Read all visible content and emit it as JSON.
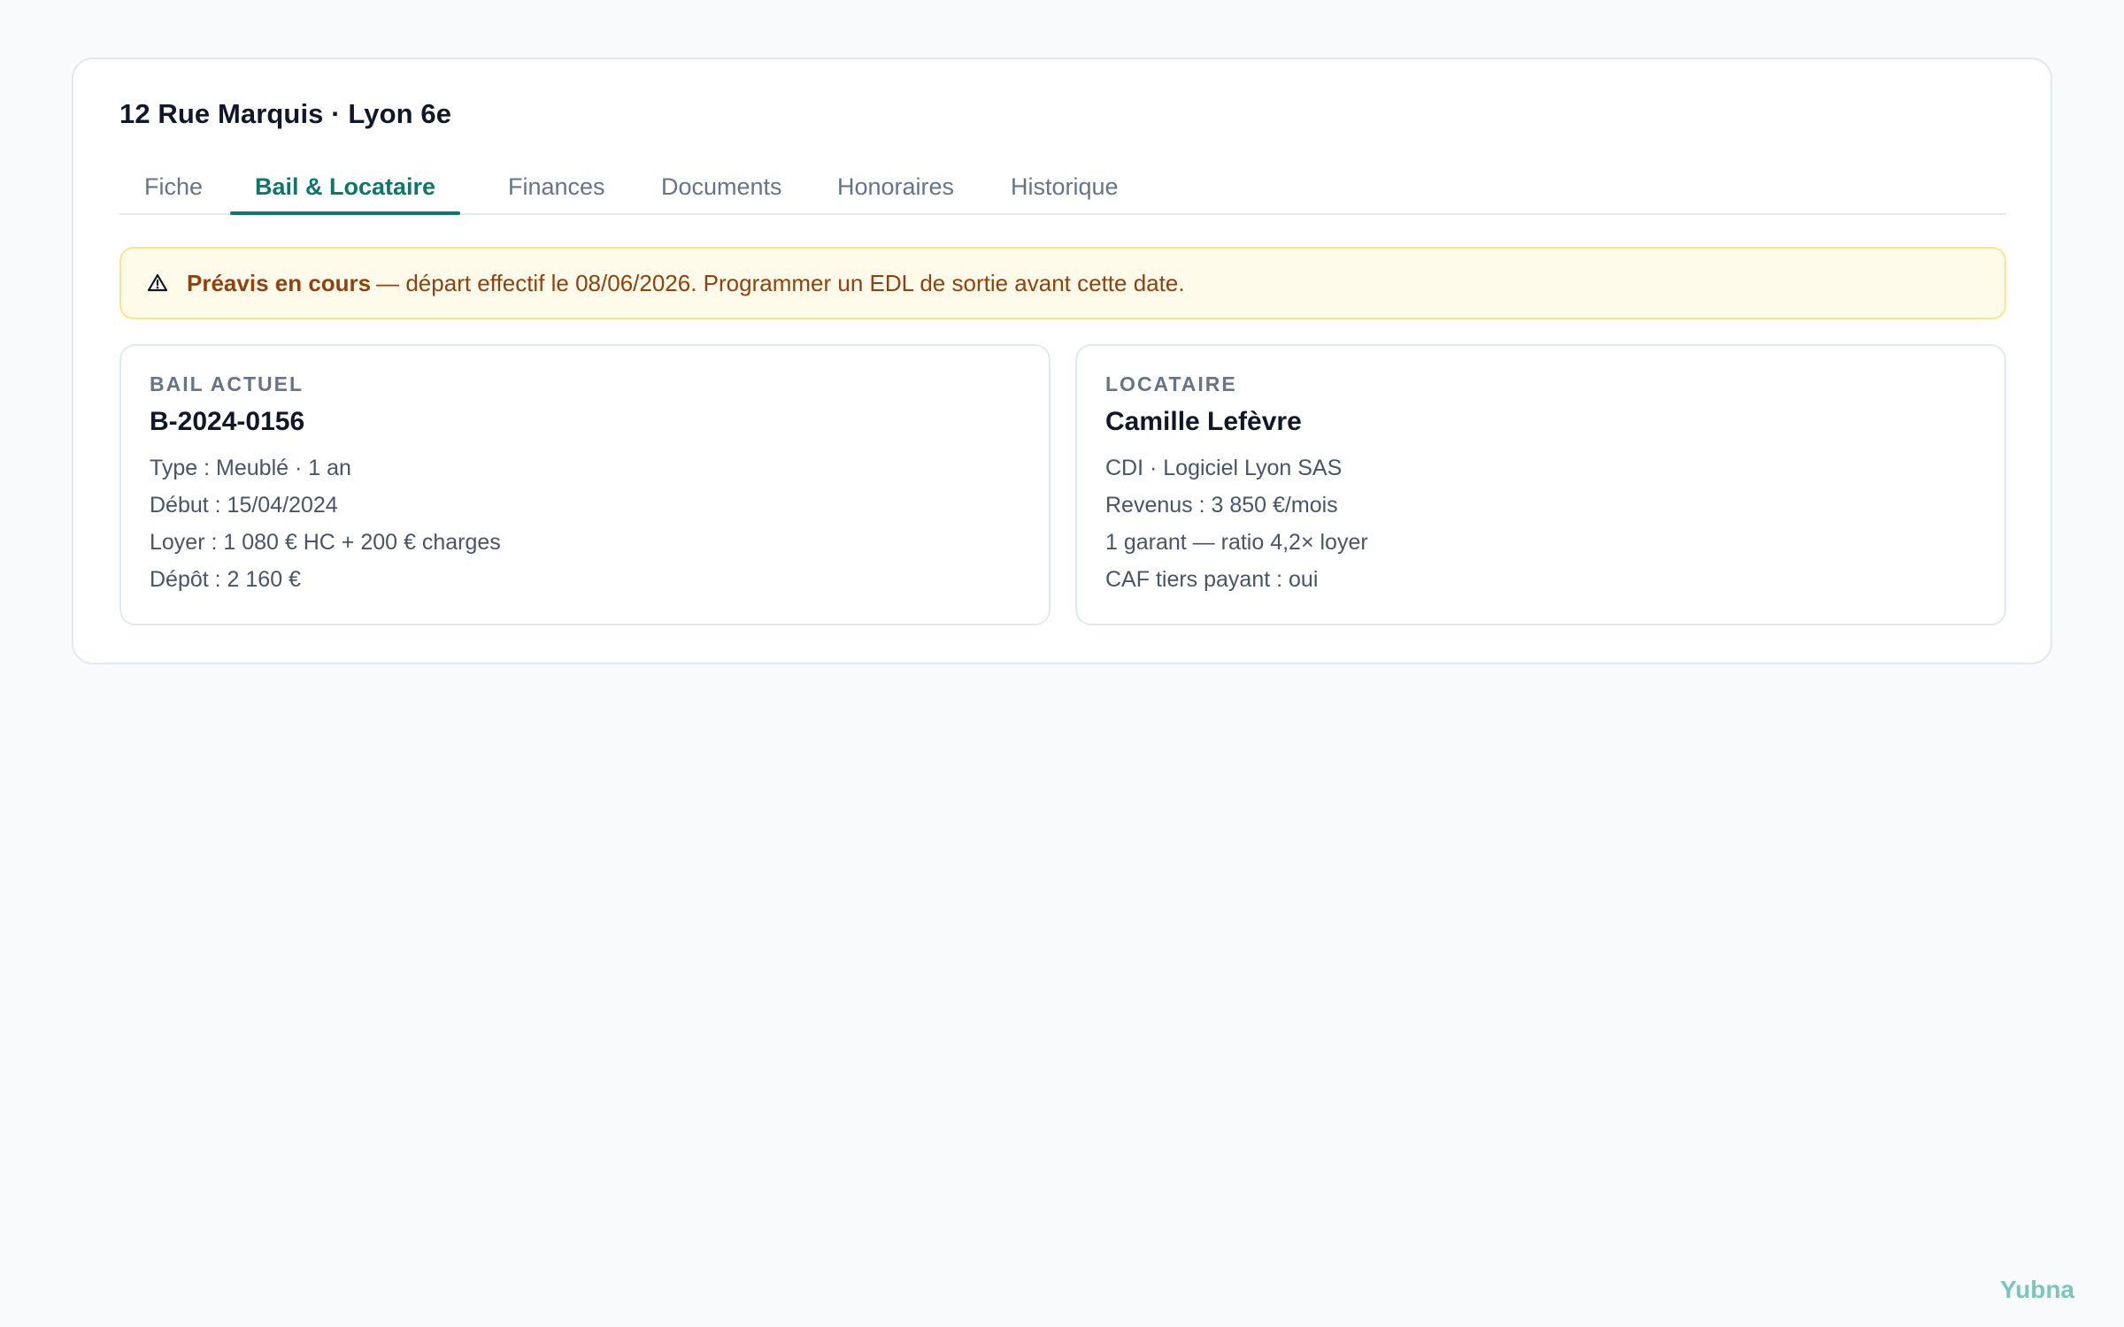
{
  "header": {
    "title": "12 Rue Marquis · Lyon 6e"
  },
  "tabs": [
    {
      "label": "Fiche",
      "active": false
    },
    {
      "label": "Bail & Locataire",
      "active": true
    },
    {
      "label": "Finances",
      "active": false
    },
    {
      "label": "Documents",
      "active": false
    },
    {
      "label": "Honoraires",
      "active": false
    },
    {
      "label": "Historique",
      "active": false
    }
  ],
  "alert": {
    "icon": "warning-triangle-icon",
    "strong": "Préavis en cours",
    "text": "— départ effectif le 08/06/2026. Programmer un EDL de sortie avant cette date."
  },
  "bail": {
    "label": "BAIL ACTUEL",
    "title": "B-2024-0156",
    "lines": [
      "Type : Meublé · 1 an",
      "Début : 15/04/2024",
      "Loyer : 1 080 € HC + 200 € charges",
      "Dépôt : 2 160 €"
    ]
  },
  "locataire": {
    "label": "LOCATAIRE",
    "title": "Camille Lefèvre",
    "lines": [
      "CDI · Logiciel Lyon SAS",
      "Revenus : 3 850 €/mois",
      "1 garant — ratio 4,2× loyer",
      "CAF tiers payant : oui"
    ]
  },
  "brand": "Yubna",
  "colors": {
    "accent": "#0f766e",
    "alert_bg": "#fefbea",
    "alert_border": "#fde68a",
    "alert_text": "#92400e",
    "brand": "#7cc5bd"
  }
}
